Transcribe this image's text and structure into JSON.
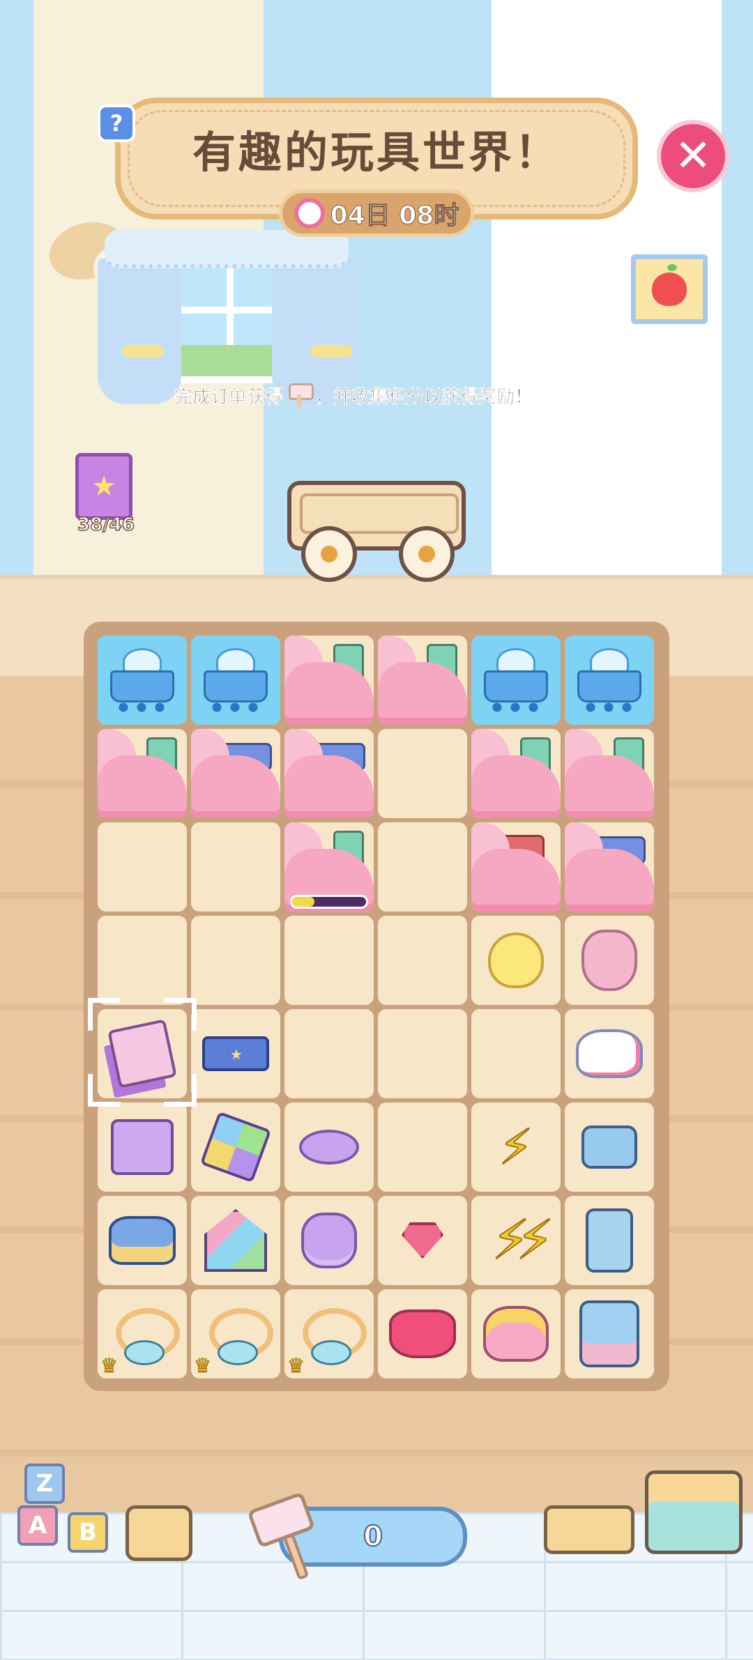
{
  "header": {
    "help_label": "?",
    "title": "有趣的玩具世界！",
    "timer": "04日 08时",
    "close_label": "✕"
  },
  "instruction": {
    "before": "完成订单获得",
    "after": "，并收集积分以获得奖励！"
  },
  "collection": {
    "count": "38/46"
  },
  "score": {
    "value": "0"
  },
  "bottom_blocks": [
    "Z",
    "A",
    "B"
  ],
  "colors": {
    "board": "#c9a27d",
    "cell": "#f8e6c8",
    "close_button": "#ec4c7e",
    "score_bar": "#a6d6f8"
  },
  "board": {
    "rows": 8,
    "cols": 6,
    "cells": [
      [
        "cart-locked",
        "cart-locked",
        "fog-green-block",
        "fog-green-block",
        "cart-locked",
        "cart-locked"
      ],
      [
        "fog-green-block",
        "fog-blue-brick",
        "fog-blue-brick",
        "empty",
        "fog-green-block",
        "fog-green-block"
      ],
      [
        "empty",
        "empty",
        "fog-green-block-progress",
        "empty",
        "fog-red-brick",
        "fog-blue-brick"
      ],
      [
        "empty",
        "empty",
        "empty",
        "empty",
        "chick-toy",
        "teddy-bear"
      ],
      [
        "toy-cubes",
        "blue-lego-brick",
        "empty",
        "empty",
        "empty",
        "rocking-horse"
      ],
      [
        "shape-sorter",
        "rubik-cubes",
        "purple-coin",
        "empty",
        "lightning-bolt",
        "robot-head"
      ],
      [
        "toy-cars",
        "block-house",
        "purple-coin-stack",
        "pink-gem",
        "lightning-bolts",
        "robot-toy"
      ],
      [
        "wind-up-key",
        "wind-up-key",
        "wind-up-key",
        "pink-gems",
        "kitty-purse",
        "robot-box"
      ]
    ],
    "crowned": [
      [
        7,
        0
      ],
      [
        7,
        1
      ],
      [
        7,
        2
      ]
    ],
    "selected": [
      4,
      0
    ],
    "progress": 0.3
  }
}
